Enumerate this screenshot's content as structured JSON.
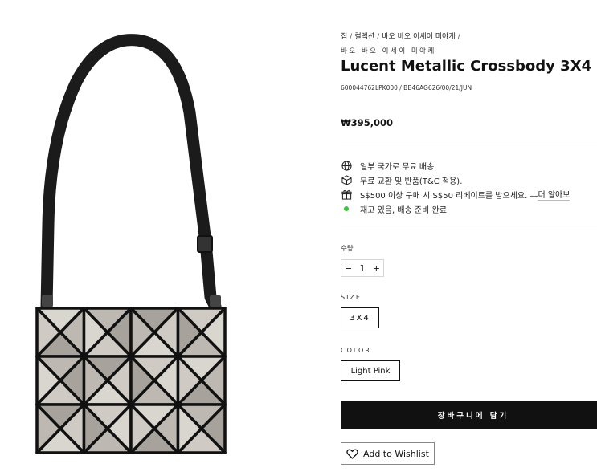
{
  "breadcrumb": [
    "집",
    "컬렉션",
    "바오 바오 이세이 미야케"
  ],
  "brand": "바오 바오 이세이 미야케",
  "product": {
    "title": "Lucent Metallic Crossbody 3X4",
    "sku": "600044762LPK000 / BB46AG626/00/21/JUN",
    "price": "₩395,000"
  },
  "features": [
    {
      "icon": "globe-icon",
      "text": "일부 국가로 무료 배송"
    },
    {
      "icon": "box-icon",
      "text": "무료 교환 및 반품(T&C 적용)."
    },
    {
      "icon": "gift-icon",
      "text": "S$500 이상 구매 시 S$50 리베이트를 받으세요. — ",
      "link": "더 알아보"
    },
    {
      "icon": "in-stock-dot-icon",
      "text": "재고 있음, 배송 준비 완료"
    }
  ],
  "quantity": {
    "label": "수량",
    "value": "1",
    "minus": "−",
    "plus": "+"
  },
  "size": {
    "label": "SIZE",
    "selected": "3X4"
  },
  "color": {
    "label": "COLOR",
    "selected": "Light Pink"
  },
  "actions": {
    "add_to_cart": "장바구니에 담기",
    "wishlist": "Add to Wishlist"
  },
  "colors": {
    "stock_dot": "#3ec43e",
    "cart_button": "#111111"
  }
}
